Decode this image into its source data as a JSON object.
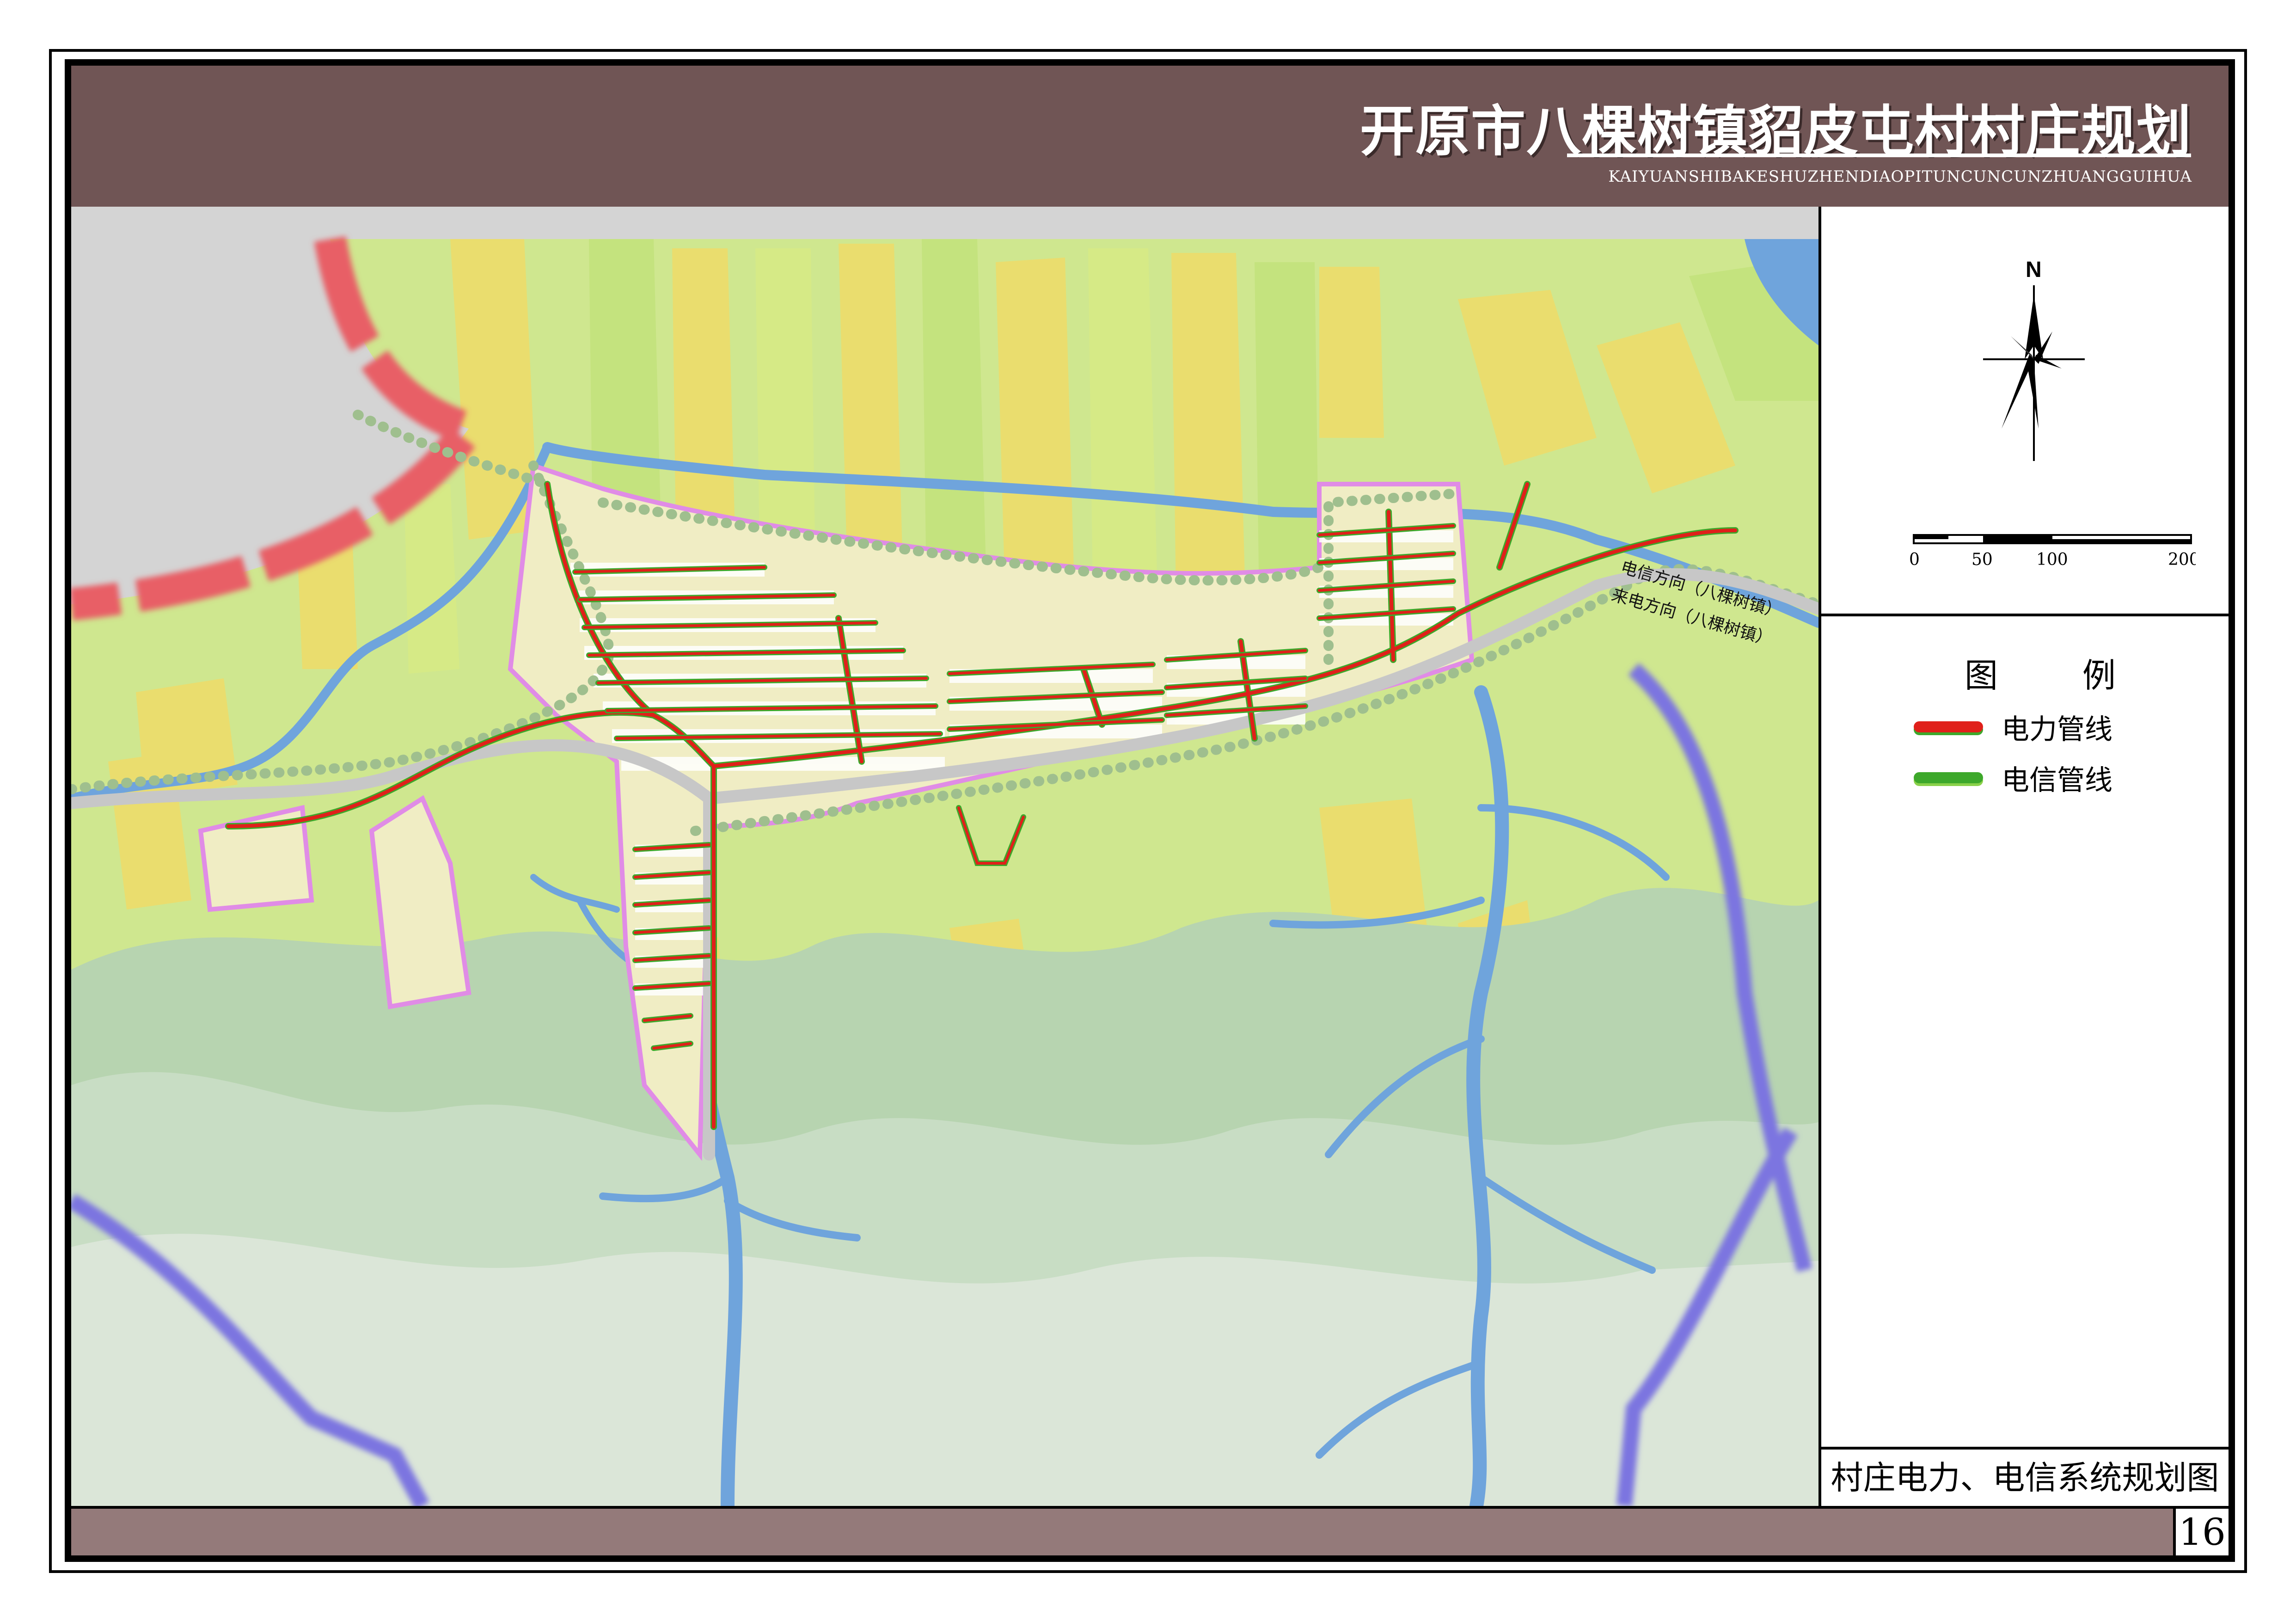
{
  "header": {
    "title": "开原市八棵树镇貂皮屯村村庄规划",
    "subtitle": "KAIYUANSHIBAKESHUZHENDIAOPITUNCUNCUNZHUANGGUIHUA"
  },
  "map": {
    "annotations": {
      "telecom_direction": "电信方向（八棵树镇）",
      "power_direction": "来电方向（八棵树镇）"
    },
    "colors": {
      "power_line": "#e0201a",
      "telecom_line": "#3da82b",
      "river": "#6fa4dc",
      "field_green": "#c4e37e",
      "field_yellow": "#eadd6e",
      "hill": "#b7d4b0",
      "village_boundary": "#e08ce6"
    }
  },
  "north_arrow": {
    "label": "N"
  },
  "scale_bar": {
    "ticks": [
      "0",
      "50",
      "100",
      "200"
    ]
  },
  "legend": {
    "title": "图  例",
    "items": [
      {
        "label": "电力管线",
        "color": "#e0201a"
      },
      {
        "label": "电信管线",
        "color": "#3da82b"
      }
    ]
  },
  "drawing_name": "村庄电力、电信系统规划图",
  "page_number": "16"
}
